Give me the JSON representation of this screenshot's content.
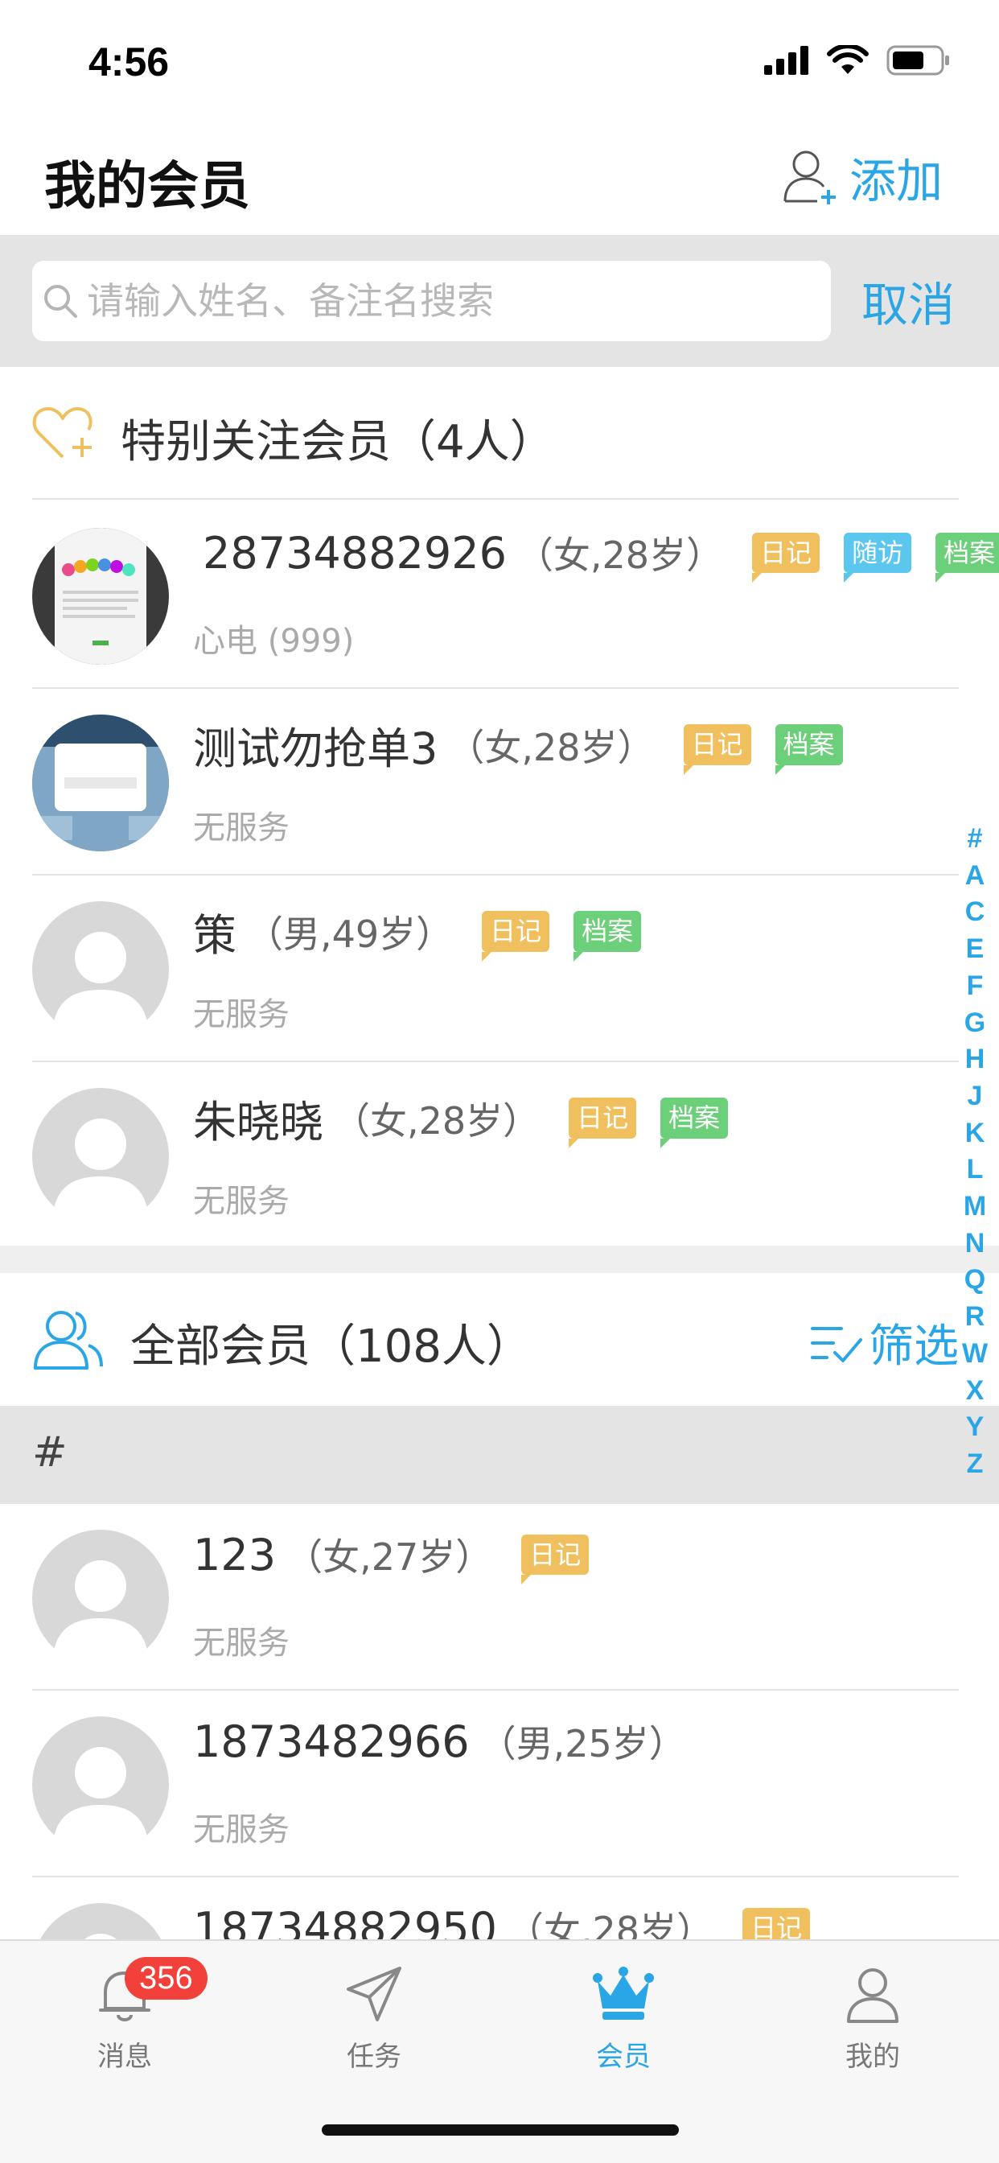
{
  "status_bar": {
    "time": "4:56"
  },
  "header": {
    "title": "我的会员",
    "add_label": "添加"
  },
  "search": {
    "placeholder": "请输入姓名、备注名搜索",
    "value": "",
    "cancel_label": "取消"
  },
  "favorites": {
    "title": "特别关注会员（4人）",
    "members": [
      {
        "name": "28734882926",
        "info": "（女,28岁）",
        "service": "心电 (999)",
        "tags": [
          "日记",
          "随访",
          "档案"
        ],
        "avatar": "photo-welcome"
      },
      {
        "name": "测试勿抢单3",
        "info": "（女,28岁）",
        "service": "无服务",
        "tags": [
          "日记",
          "档案"
        ],
        "avatar": "photo-apple"
      },
      {
        "name": "策",
        "info": "（男,49岁）",
        "service": "无服务",
        "tags": [
          "日记",
          "档案"
        ],
        "avatar": "default"
      },
      {
        "name": "朱晓晓",
        "info": "（女,28岁）",
        "service": "无服务",
        "tags": [
          "日记",
          "档案"
        ],
        "avatar": "default"
      }
    ]
  },
  "all_members": {
    "title": "全部会员（108人）",
    "filter_label": "筛选",
    "letter": "#",
    "members": [
      {
        "name": "123",
        "info": "（女,27岁）",
        "service": "无服务",
        "tags": [
          "日记"
        ],
        "avatar": "default"
      },
      {
        "name": "1873482966",
        "info": "（男,25岁）",
        "service": "无服务",
        "tags": [],
        "avatar": "default"
      },
      {
        "name": "18734882950",
        "info": "（女,28岁）",
        "service": "",
        "tags": [
          "日记"
        ],
        "avatar": "default"
      }
    ]
  },
  "index_letters": [
    "#",
    "A",
    "C",
    "E",
    "F",
    "G",
    "H",
    "J",
    "K",
    "L",
    "M",
    "N",
    "Q",
    "R",
    "W",
    "X",
    "Y",
    "Z"
  ],
  "tab_bar": {
    "tabs": [
      {
        "label": "消息",
        "icon": "bell-icon",
        "badge": "356"
      },
      {
        "label": "任务",
        "icon": "paper-plane-icon"
      },
      {
        "label": "会员",
        "icon": "crown-icon",
        "active": true
      },
      {
        "label": "我的",
        "icon": "user-icon"
      }
    ]
  },
  "colors": {
    "accent": "#2aa6e6",
    "diary_tag": "#f1c05e",
    "visit_tag": "#5bc6ee",
    "file_tag": "#6ccf7a",
    "badge": "#f2403a"
  }
}
